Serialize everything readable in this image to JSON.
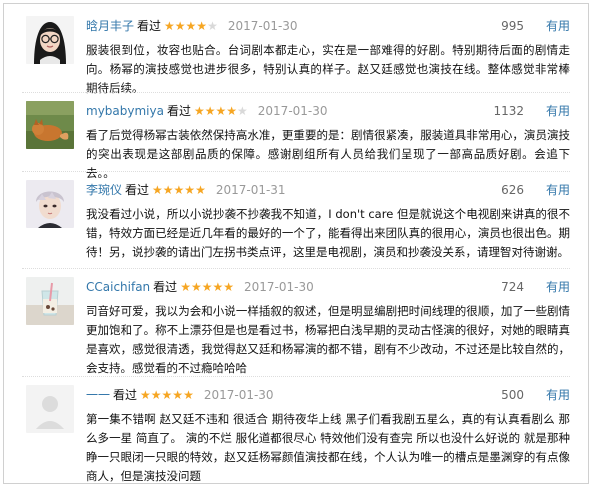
{
  "reviews": [
    {
      "author": "晗月丰子",
      "watched": "看过",
      "rating": 4,
      "date": "2017-01-30",
      "votes": "995",
      "useful": "有用",
      "avatar": "avatar-girl-glasses",
      "text": "服装很到位，妆容也贴合。台词剧本都走心，实在是一部难得的好剧。特别期待后面的剧情走向。杨幂的演技感觉也进步很多，特别认真的样子。赵又廷感觉也演技在线。整体感觉非常棒 期待后续。"
    },
    {
      "author": "mybabymiya",
      "watched": "看过",
      "rating": 4,
      "date": "2017-01-30",
      "votes": "1132",
      "useful": "有用",
      "avatar": "avatar-fox",
      "text": "看了后觉得杨幂古装依然保持高水准，更重要的是：剧情很紧凑，服装道具非常用心，演员演技的突出表现是这部剧品质的保障。感谢剧组所有人员给我们呈现了一部高品质好剧。会追下去。。"
    },
    {
      "author": "李琬仪",
      "watched": "看过",
      "rating": 5,
      "date": "2017-01-31",
      "votes": "626",
      "useful": "有用",
      "avatar": "avatar-boy",
      "text": "我没看过小说，所以小说抄袭不抄袭我不知道，I don't care 但是就说这个电视剧来讲真的很不错，特效方面已经是近几年看的最好的一个了，能看得出来团队真的很用心，演员也很出色。期待！另，说抄袭的请出门左拐书类点评，这里是电视剧，演员和抄袭没关系，请理智对待谢谢。"
    },
    {
      "author": "CCaichifan",
      "watched": "看过",
      "rating": 5,
      "date": "2017-01-30",
      "votes": "724",
      "useful": "有用",
      "avatar": "avatar-drink",
      "text": "司音好可爱，我以为会和小说一样插叙的叙述，但是明显编剧把时间线理的很顺，加了一些剧情更加饱和了。称不上漂芬但是也是看过书，杨幂把白浅早期的灵动古怪演的很好，对她的眼睛真是喜欢，感觉很清透，我觉得赵又廷和杨幂演的都不错，剧有不少改动，不过还是比较自然的，会支持。感觉看的不过瘾哈哈哈"
    },
    {
      "author": "一一",
      "watched": "看过",
      "rating": 5,
      "date": "2017-01-30",
      "votes": "500",
      "useful": "有用",
      "avatar": "avatar-blank",
      "text": "第一集不错啊 赵又廷不违和 很适合 期待夜华上线 黑子们看我剧五星么，真的有认真看剧么 那么多一星 简直了。 演的不烂 服化道都很尽心 特效他们没有查完 所以也没什么好说的 就是那种睁一只眼闭一只眼的特效，赵又廷杨幂颜值演技都在线，个人认为唯一的槽点是墨渊穿的有点像商人，但是演技没问题"
    }
  ]
}
